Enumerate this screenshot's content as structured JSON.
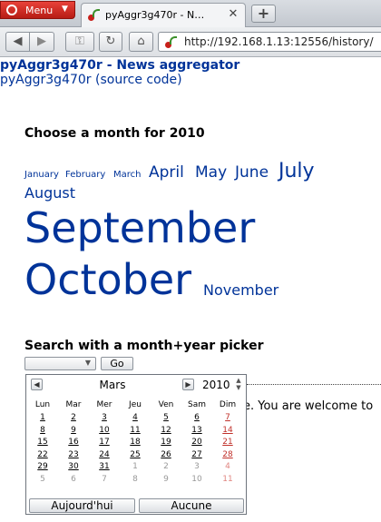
{
  "browser": {
    "menu_label": "Menu",
    "tab_title": "pyAggr3g470r - N…",
    "address": "http://192.168.1.13:12556/history/"
  },
  "page": {
    "site_title": "pyAggr3g470r - News aggregator",
    "source_link": "pyAggr3g470r (source code)",
    "month_heading": "Choose a month for 2010",
    "months": [
      "January",
      "February",
      "March",
      "April",
      "May",
      "June",
      "July",
      "August",
      "September",
      "October",
      "November"
    ],
    "picker_heading": "Search with a month+year picker",
    "select_value": "",
    "go_label": "Go",
    "behind_text": "e. You are welcome to"
  },
  "calendar": {
    "month": "Mars",
    "year": "2010",
    "weekdays": [
      "Lun",
      "Mar",
      "Mer",
      "Jeu",
      "Ven",
      "Sam",
      "Dim"
    ],
    "weeks": [
      [
        "1",
        "2",
        "3",
        "4",
        "5",
        "6",
        "7"
      ],
      [
        "8",
        "9",
        "10",
        "11",
        "12",
        "13",
        "14"
      ],
      [
        "15",
        "16",
        "17",
        "18",
        "19",
        "20",
        "21"
      ],
      [
        "22",
        "23",
        "24",
        "25",
        "26",
        "27",
        "28"
      ],
      [
        "29",
        "30",
        "31",
        "1",
        "2",
        "3",
        "4"
      ],
      [
        "5",
        "6",
        "7",
        "8",
        "9",
        "10",
        "11"
      ]
    ],
    "today_label": "Aujourd'hui",
    "none_label": "Aucune"
  }
}
